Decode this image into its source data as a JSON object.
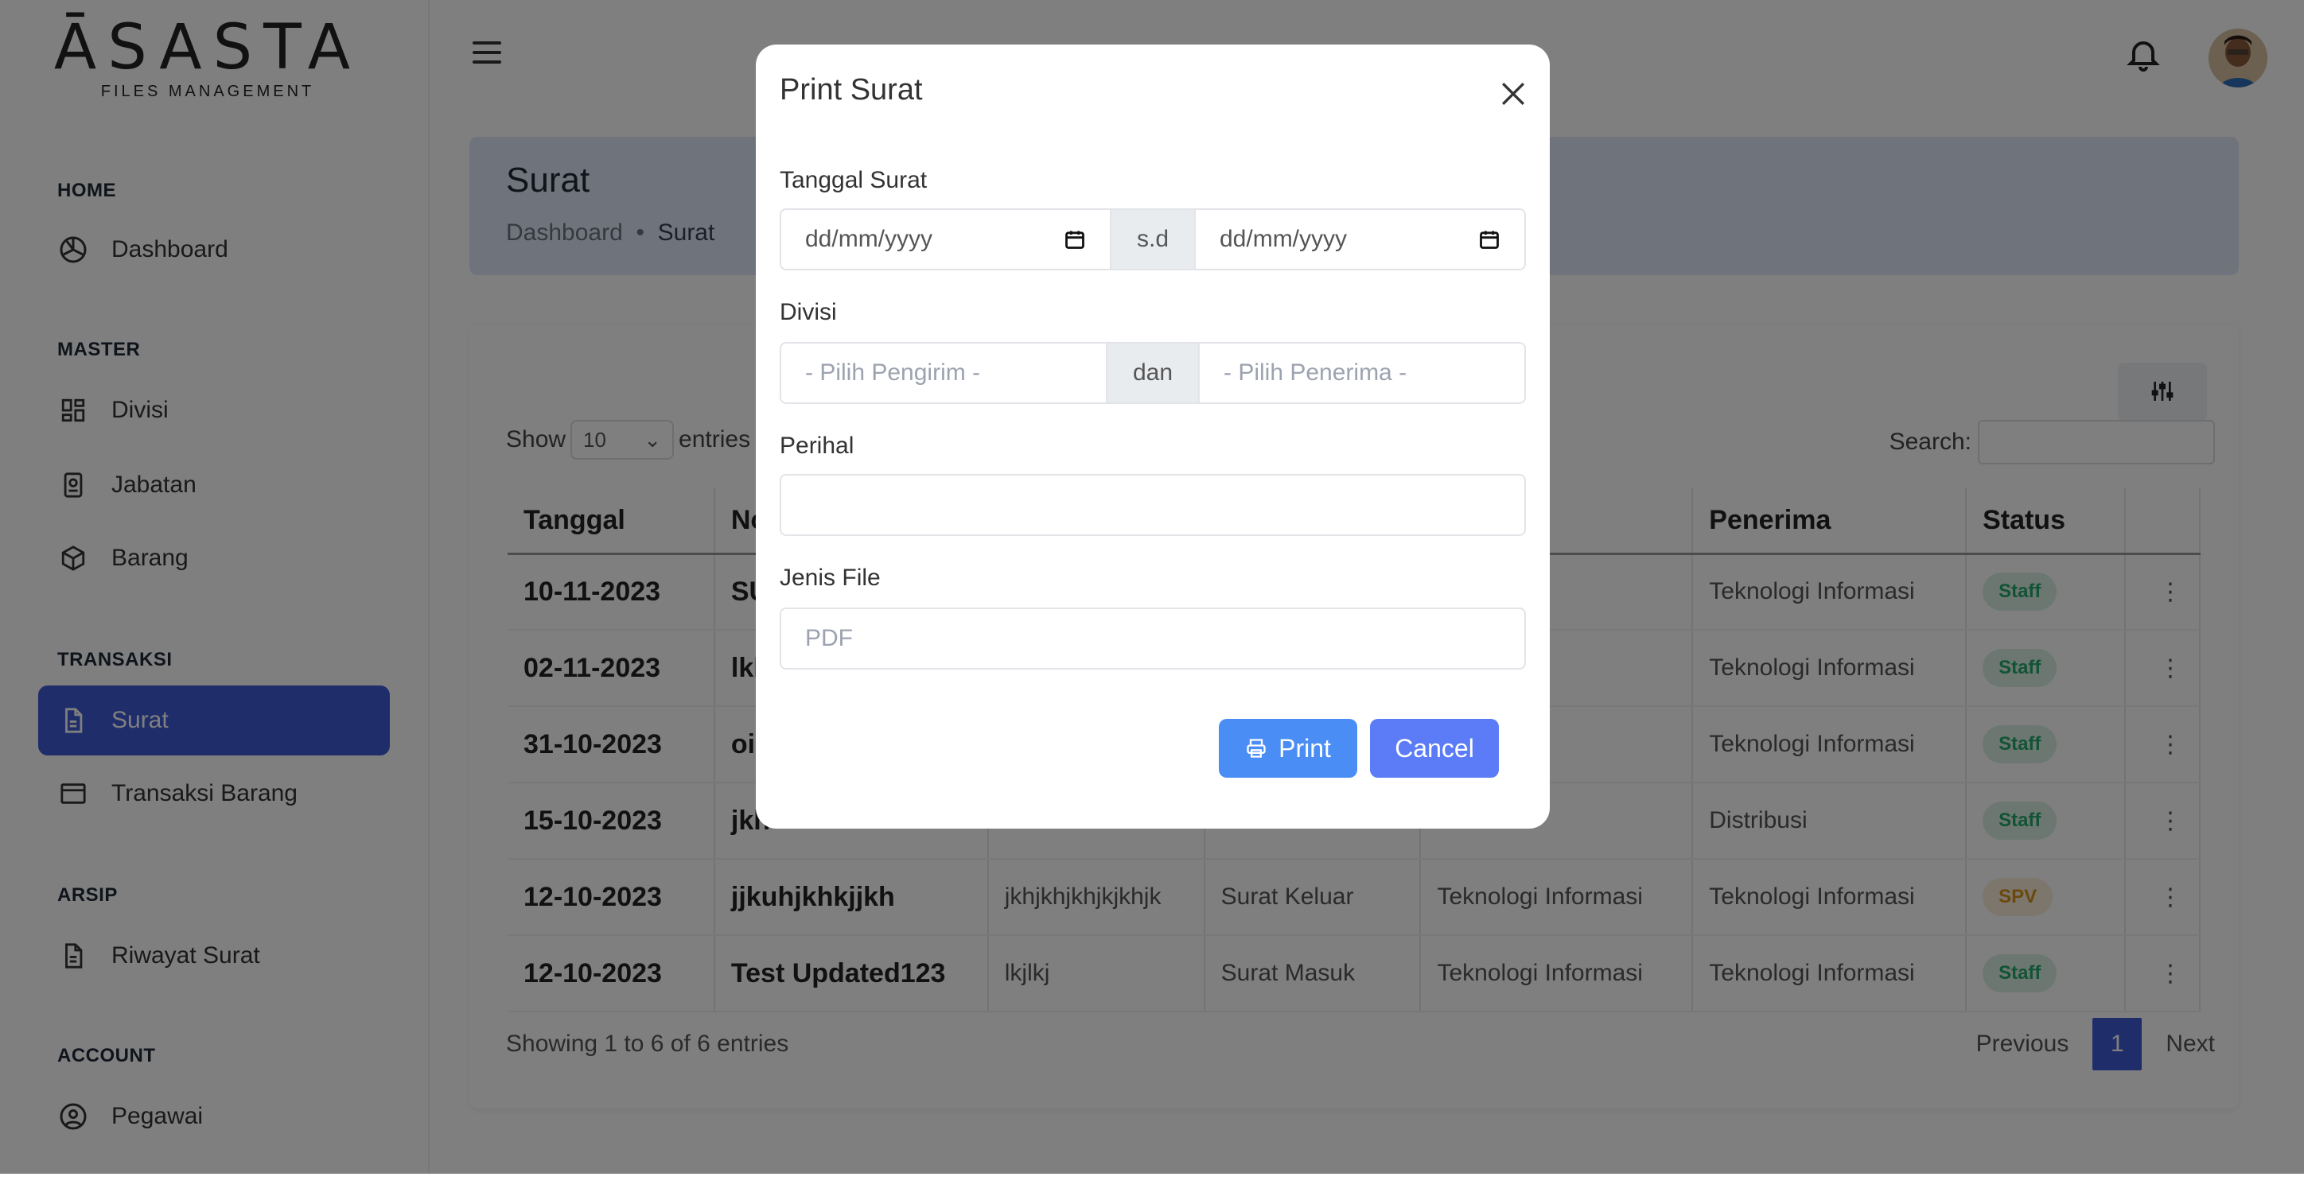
{
  "app": {
    "logo_main": "ĀSASTA",
    "logo_sub": "FILES MANAGEMENT"
  },
  "sidebar": {
    "sections": [
      {
        "label": "HOME",
        "items": [
          {
            "label": "Dashboard",
            "icon": "dashboard-icon"
          }
        ]
      },
      {
        "label": "MASTER",
        "items": [
          {
            "label": "Divisi",
            "icon": "grid-icon"
          },
          {
            "label": "Jabatan",
            "icon": "id-badge-icon"
          },
          {
            "label": "Barang",
            "icon": "box-icon"
          }
        ]
      },
      {
        "label": "TRANSAKSI",
        "items": [
          {
            "label": "Surat",
            "icon": "document-icon",
            "active": true
          },
          {
            "label": "Transaksi Barang",
            "icon": "window-icon"
          }
        ]
      },
      {
        "label": "ARSIP",
        "items": [
          {
            "label": "Riwayat Surat",
            "icon": "document-icon"
          }
        ]
      },
      {
        "label": "ACCOUNT",
        "items": [
          {
            "label": "Pegawai",
            "icon": "user-circle-icon"
          }
        ]
      }
    ]
  },
  "header": {
    "page_title": "Surat",
    "breadcrumb": [
      "Dashboard",
      "Surat"
    ]
  },
  "table": {
    "show_label": "Show",
    "show_value": "10",
    "entries_label": "entries",
    "search_label": "Search:",
    "columns": [
      "Tanggal",
      "No",
      "",
      "",
      "",
      "Penerima",
      "Status",
      ""
    ],
    "rows": [
      {
        "tanggal": "10-11-2023",
        "no": "SU",
        "perihal": "",
        "jenis": "",
        "pengirim": "",
        "penerima": "Teknologi Informasi",
        "status": "Staff"
      },
      {
        "tanggal": "02-11-2023",
        "no": "lkl",
        "perihal": "",
        "jenis": "",
        "pengirim": "",
        "penerima": "Teknologi Informasi",
        "status": "Staff"
      },
      {
        "tanggal": "31-10-2023",
        "no": "oi",
        "perihal": "",
        "jenis": "",
        "pengirim": "nformasi",
        "penerima": "Teknologi Informasi",
        "status": "Staff"
      },
      {
        "tanggal": "15-10-2023",
        "no": "jkh",
        "perihal": "",
        "jenis": "",
        "pengirim": "",
        "penerima": "Distribusi",
        "status": "Staff"
      },
      {
        "tanggal": "12-10-2023",
        "no": "jjkuhjkhkjjkh",
        "perihal": "jkhjkhjkhjkjkhjk",
        "jenis": "Surat Keluar",
        "pengirim": "Teknologi Informasi",
        "penerima": "Teknologi Informasi",
        "status": "SPV"
      },
      {
        "tanggal": "12-10-2023",
        "no": "Test Updated123",
        "perihal": "lkjlkj",
        "jenis": "Surat Masuk",
        "pengirim": "Teknologi Informasi",
        "penerima": "Teknologi Informasi",
        "status": "Staff"
      }
    ],
    "showing": "Showing 1 to 6 of 6 entries",
    "prev": "Previous",
    "page": "1",
    "next": "Next"
  },
  "modal": {
    "title": "Print Surat",
    "tanggal_label": "Tanggal Surat",
    "date_from_placeholder": "dd/mm/yyyy",
    "date_sep": "s.d",
    "date_to_placeholder": "dd/mm/yyyy",
    "divisi_label": "Divisi",
    "pengirim_placeholder": "- Pilih Pengirim -",
    "divisi_sep": "dan",
    "penerima_placeholder": "- Pilih Penerima -",
    "perihal_label": "Perihal",
    "perihal_value": "",
    "jenis_label": "Jenis File",
    "jenis_value": "PDF",
    "print_label": "Print",
    "cancel_label": "Cancel"
  },
  "colors": {
    "primary": "#3f5bd6",
    "print_button": "#4a8ef5",
    "cancel_button": "#5b7cf6",
    "staff_badge": "#27a66b",
    "spv_badge": "#d6921a"
  }
}
